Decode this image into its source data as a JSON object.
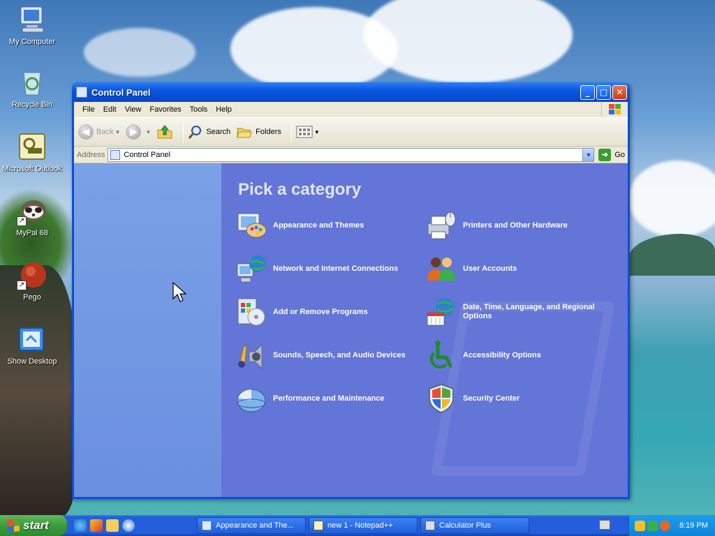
{
  "desktop": {
    "icons": [
      {
        "label": "My Computer",
        "icon": "my-computer-icon"
      },
      {
        "label": "Recycle Bin",
        "icon": "recycle-bin-icon"
      },
      {
        "label": "Microsoft Outlook",
        "icon": "outlook-icon"
      },
      {
        "label": "MyPal 68",
        "icon": "mypal-icon"
      },
      {
        "label": "Pego",
        "icon": "pego-icon"
      },
      {
        "label": "Show Desktop",
        "icon": "show-desktop-icon"
      }
    ]
  },
  "window": {
    "title": "Control Panel",
    "menu": [
      "File",
      "Edit",
      "View",
      "Favorites",
      "Tools",
      "Help"
    ],
    "toolbar": {
      "back_label": "Back",
      "search_label": "Search",
      "folders_label": "Folders"
    },
    "address": {
      "label": "Address",
      "value": "Control Panel",
      "go_label": "Go"
    },
    "main": {
      "title": "Pick a category",
      "categories_left": [
        {
          "label": "Appearance and Themes",
          "icon": "appearance-themes-icon"
        },
        {
          "label": "Network and Internet Connections",
          "icon": "network-icon"
        },
        {
          "label": "Add or Remove Programs",
          "icon": "add-remove-programs-icon"
        },
        {
          "label": "Sounds, Speech, and Audio Devices",
          "icon": "sounds-icon"
        },
        {
          "label": "Performance and Maintenance",
          "icon": "performance-icon"
        }
      ],
      "categories_right": [
        {
          "label": "Printers and Other Hardware",
          "icon": "printers-icon"
        },
        {
          "label": "User Accounts",
          "icon": "user-accounts-icon"
        },
        {
          "label": "Date, Time, Language, and Regional Options",
          "icon": "date-time-icon"
        },
        {
          "label": "Accessibility Options",
          "icon": "accessibility-icon"
        },
        {
          "label": "Security Center",
          "icon": "security-center-icon"
        }
      ]
    }
  },
  "taskbar": {
    "start_label": "start",
    "tasks": [
      {
        "label": "Appearance and The..."
      },
      {
        "label": "new 1 - Notepad++"
      },
      {
        "label": "Calculator Plus"
      }
    ],
    "clock": "8:19 PM"
  },
  "colors": {
    "content_bg": "#6375d6",
    "taskpane_bg": "#7aa1e6",
    "title_blue": "#0a56e0",
    "start_green": "#3c9a3c"
  }
}
